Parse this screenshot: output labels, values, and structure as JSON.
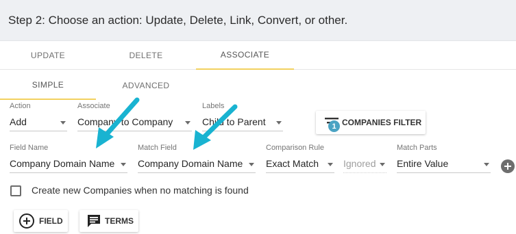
{
  "step": {
    "title": "Step 2: Choose an action: Update, Delete, Link, Convert, or other."
  },
  "tabs": {
    "update": "UPDATE",
    "delete": "DELETE",
    "associate": "ASSOCIATE",
    "active": "associate"
  },
  "subtabs": {
    "simple": "SIMPLE",
    "advanced": "ADVANCED",
    "active": "simple"
  },
  "row1": {
    "action": {
      "label": "Action",
      "value": "Add"
    },
    "associate": {
      "label": "Associate",
      "value": "Company to Company"
    },
    "labels": {
      "label": "Labels",
      "value": "Child to Parent"
    },
    "filter_button": {
      "label": "COMPANIES FILTER",
      "badge": "1"
    }
  },
  "row2": {
    "field_name": {
      "label": "Field Name",
      "value": "Company Domain Name"
    },
    "match_field": {
      "label": "Match Field",
      "value": "Company Domain Name"
    },
    "comparison_rule": {
      "label": "Comparison Rule",
      "value": "Exact Match"
    },
    "ignored": {
      "value": "Ignored"
    },
    "match_parts": {
      "label": "Match Parts",
      "value": "Entire Value"
    }
  },
  "checkbox": {
    "label": "Create new Companies when no matching is found",
    "checked": false
  },
  "buttons": {
    "field": "FIELD",
    "terms": "TERMS"
  },
  "colors": {
    "accent_underline": "#f2d15e",
    "annotation_arrow": "#19b3d1",
    "badge": "#4ba3c3"
  },
  "icons": [
    "filter-icon",
    "add-circle-icon",
    "plus-circle-icon",
    "comment-icon",
    "chevron-down-icon",
    "annotation-arrow"
  ]
}
